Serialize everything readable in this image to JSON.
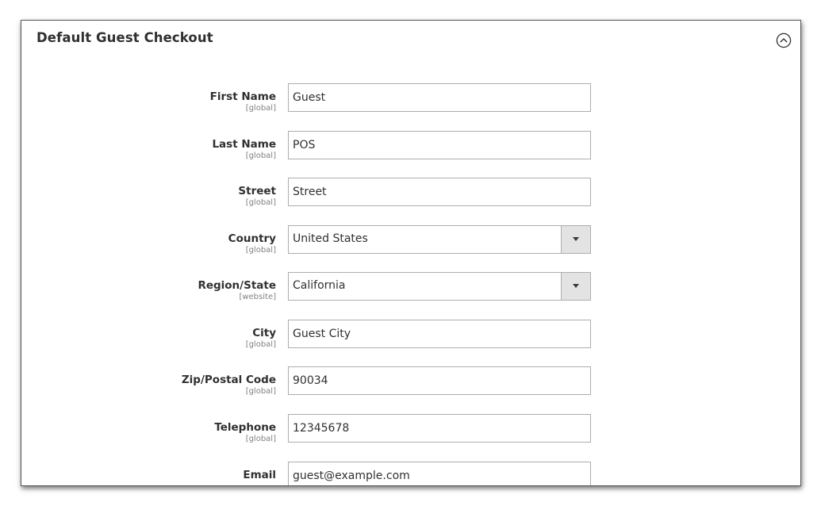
{
  "section": {
    "title": "Default Guest Checkout",
    "toggle_icon": "chevron-up-circle-icon"
  },
  "fields": [
    {
      "label": "First Name",
      "scope": "[global]",
      "type": "text",
      "value": "Guest"
    },
    {
      "label": "Last Name",
      "scope": "[global]",
      "type": "text",
      "value": "POS"
    },
    {
      "label": "Street",
      "scope": "[global]",
      "type": "text",
      "value": "Street"
    },
    {
      "label": "Country",
      "scope": "[global]",
      "type": "select",
      "value": "United States"
    },
    {
      "label": "Region/State",
      "scope": "[website]",
      "type": "select",
      "value": "California"
    },
    {
      "label": "City",
      "scope": "[global]",
      "type": "text",
      "value": "Guest City"
    },
    {
      "label": "Zip/Postal Code",
      "scope": "[global]",
      "type": "text",
      "value": "90034"
    },
    {
      "label": "Telephone",
      "scope": "[global]",
      "type": "text",
      "value": "12345678"
    },
    {
      "label": "Email",
      "scope": "",
      "type": "text",
      "value": "guest@example.com"
    }
  ],
  "colors": {
    "text": "#303030",
    "scope": "#808080",
    "border": "#adadad",
    "select_button": "#e3e3e3"
  }
}
